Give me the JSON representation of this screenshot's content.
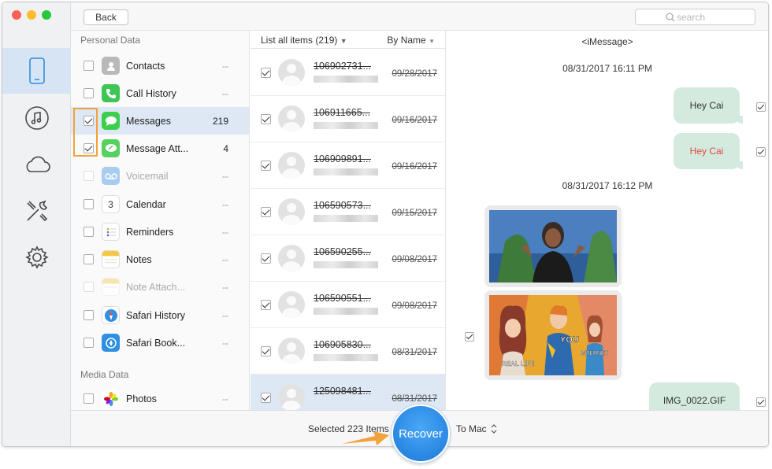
{
  "toolbar": {
    "back_label": "Back",
    "search_placeholder": "search"
  },
  "rail": {
    "items": [
      "device-icon",
      "music-icon",
      "cloud-icon",
      "tools-icon",
      "settings-icon"
    ],
    "active": "device-icon"
  },
  "categories": {
    "personal_title": "Personal Data",
    "media_title": "Media Data",
    "items": [
      {
        "label": "Contacts",
        "count": "--",
        "checked": false,
        "disabled": false,
        "icon": "contacts-icon"
      },
      {
        "label": "Call History",
        "count": "--",
        "checked": false,
        "disabled": false,
        "icon": "phone-icon"
      },
      {
        "label": "Messages",
        "count": "219",
        "checked": true,
        "disabled": false,
        "icon": "messages-icon",
        "selected": true
      },
      {
        "label": "Message Att...",
        "count": "4",
        "checked": true,
        "disabled": false,
        "icon": "message-attachment-icon"
      },
      {
        "label": "Voicemail",
        "count": "--",
        "checked": false,
        "disabled": true,
        "icon": "voicemail-icon"
      },
      {
        "label": "Calendar",
        "count": "--",
        "checked": false,
        "disabled": false,
        "icon": "calendar-icon",
        "calendar_day": "3"
      },
      {
        "label": "Reminders",
        "count": "--",
        "checked": false,
        "disabled": false,
        "icon": "reminders-icon"
      },
      {
        "label": "Notes",
        "count": "--",
        "checked": false,
        "disabled": false,
        "icon": "notes-icon"
      },
      {
        "label": "Note Attach...",
        "count": "--",
        "checked": false,
        "disabled": true,
        "icon": "note-attachment-icon"
      },
      {
        "label": "Safari History",
        "count": "--",
        "checked": false,
        "disabled": false,
        "icon": "safari-icon"
      },
      {
        "label": "Safari Book...",
        "count": "--",
        "checked": false,
        "disabled": false,
        "icon": "safari-bookmark-icon"
      }
    ],
    "media_items": [
      {
        "label": "Photos",
        "count": "--",
        "checked": false,
        "icon": "photos-icon"
      }
    ]
  },
  "list": {
    "header_all": "List all items (219)",
    "header_sort": "By Name",
    "rows": [
      {
        "number": "106902731...",
        "date": "09/28/2017",
        "checked": true
      },
      {
        "number": "106911665...",
        "date": "09/16/2017",
        "checked": true
      },
      {
        "number": "106909891...",
        "date": "09/16/2017",
        "checked": true
      },
      {
        "number": "106590573...",
        "date": "09/15/2017",
        "checked": true
      },
      {
        "number": "106590255...",
        "date": "09/08/2017",
        "checked": true
      },
      {
        "number": "106590551...",
        "date": "09/08/2017",
        "checked": true
      },
      {
        "number": "106905830...",
        "date": "08/31/2017",
        "checked": true
      },
      {
        "number": "125098481...",
        "date": "08/31/2017",
        "checked": true,
        "selected": true
      }
    ]
  },
  "detail": {
    "title": "<iMessage>",
    "timestamp_1": "08/31/2017 16:11 PM",
    "timestamp_2": "08/31/2017 16:12 PM",
    "bubble_1": "Hey Cai",
    "bubble_2": "Hey Cai",
    "bubble_2_color": "#e0483a",
    "attachment_label": "IMG_0022.GIF",
    "meme_text_1": "YOU",
    "meme_text_2": "REAL LIFE",
    "meme_text_3": "INTERNET"
  },
  "bottom": {
    "selected_text": "Selected 223 Items",
    "recover_label": "Recover",
    "destination": "To Mac"
  },
  "colors": {
    "accent": "#2f8fe2",
    "highlight": "#f0a33a",
    "bubble": "#d4eadf",
    "selected_row": "#dde8f4"
  }
}
